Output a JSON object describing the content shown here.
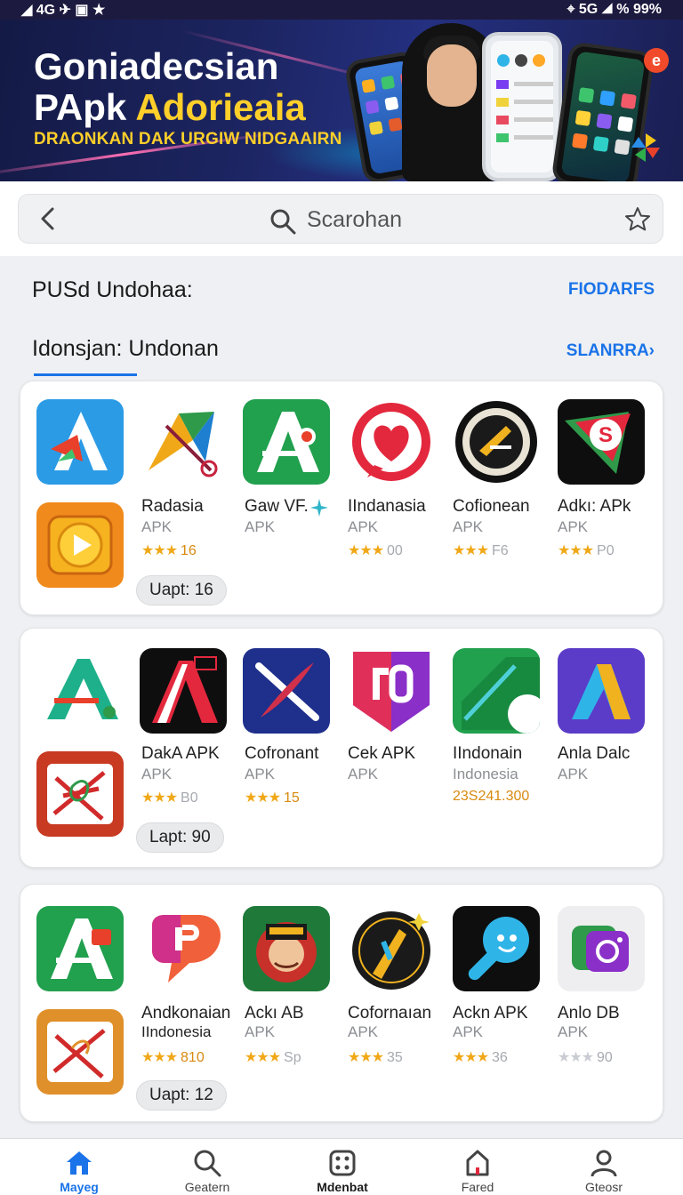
{
  "status_bar": {
    "left": "◢ 4G ✈ ▣ ★",
    "right": "⌖ 5G ◢ % 99%"
  },
  "banner": {
    "title_line1": "Goniadecsian",
    "title_line2_a": "PApk ",
    "title_line2_b": "Adorieaia",
    "tagline": "DRAONKAN DAK URGIW NIDGAAIRN",
    "badge_letter": "e"
  },
  "search": {
    "placeholder": "Scarohan"
  },
  "section1": {
    "title": "PUSd Undohaa:",
    "link": "FIODARFS"
  },
  "section2": {
    "title": "Idonsjan: Undonan",
    "link": "SLANRRA›"
  },
  "cards": [
    {
      "apps": [
        {
          "name": "Radasia",
          "sub": "APK",
          "stars": "★★★",
          "rating": "16"
        },
        {
          "name": "Gaw VF.",
          "sub": "APK"
        },
        {
          "name": "IIndanasia",
          "sub": "APK",
          "stars": "★★★",
          "rating": "00"
        },
        {
          "name": "Cofionean",
          "sub": "APK",
          "stars": "★★★",
          "rating": "F6"
        },
        {
          "name": "Adkı: APk",
          "sub": "APK",
          "stars": "★★★",
          "rating": "P0"
        }
      ],
      "update": "Uapt:  16"
    },
    {
      "apps": [
        {
          "name": "DakA APK",
          "sub": "APK",
          "stars": "★★★",
          "rating": "B0"
        },
        {
          "name": "Cofronant",
          "sub": "APK",
          "stars": "★★★",
          "rating": "15"
        },
        {
          "name": "Cek  APK",
          "sub": "APK"
        },
        {
          "name": "IIndonain",
          "sub": "Indonesia",
          "extra": "23S241.300"
        },
        {
          "name": "Anla Dalc",
          "sub": "APK"
        }
      ],
      "update": "Lapt:  90"
    },
    {
      "apps": [
        {
          "name": "Andkonaian",
          "sub": "IIndonesia",
          "stars": "★★★",
          "rating": "810"
        },
        {
          "name": "Ackı AB",
          "sub": "APK",
          "stars": "★★★",
          "rating": "Sp"
        },
        {
          "name": "Cofornaıan",
          "sub": "APK",
          "stars": "★★★",
          "rating": "35"
        },
        {
          "name": "Ackn APK",
          "sub": "APK",
          "stars": "★★★",
          "rating": "36"
        },
        {
          "name": "Anlo DB",
          "sub": "APK",
          "stars": "★★★",
          "rating": "90"
        }
      ],
      "update": "Uapt:  12"
    }
  ],
  "nav": [
    {
      "label": "Mayeg"
    },
    {
      "label": "Geatern"
    },
    {
      "label": "Mdenbat"
    },
    {
      "label": "Fared"
    },
    {
      "label": "Gteosr"
    }
  ],
  "colors": {
    "accent": "#1a73e8",
    "star": "#f0a818",
    "banner_bg": "#1c2460",
    "banner_yellow": "#ffcf2a"
  }
}
